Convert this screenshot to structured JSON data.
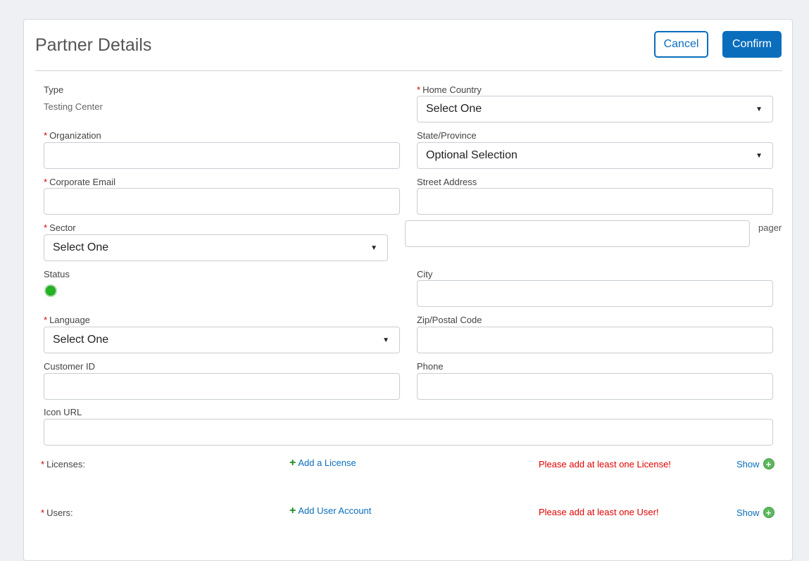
{
  "header": {
    "title": "Partner Details",
    "cancel_label": "Cancel",
    "confirm_label": "Confirm"
  },
  "fields": {
    "type": {
      "label": "Type",
      "value": "Testing Center"
    },
    "organization": {
      "label": "Organization",
      "value": ""
    },
    "corporate_email": {
      "label": "Corporate Email",
      "value": ""
    },
    "sector": {
      "label": "Sector",
      "value": "Select One"
    },
    "status": {
      "label": "Status",
      "color": "#22b522"
    },
    "language": {
      "label": "Language",
      "value": "Select One"
    },
    "customer_id": {
      "label": "Customer ID",
      "value": ""
    },
    "icon_url": {
      "label": "Icon URL",
      "value": ""
    },
    "home_country": {
      "label": "Home Country",
      "value": "Select One"
    },
    "state_province": {
      "label": "State/Province",
      "value": "Optional Selection"
    },
    "street_address": {
      "label": "Street Address",
      "value": ""
    },
    "street_address_2": {
      "value": "",
      "suffix": "pager"
    },
    "city": {
      "label": "City",
      "value": ""
    },
    "zip": {
      "label": "Zip/Postal Code",
      "value": ""
    },
    "phone": {
      "label": "Phone",
      "value": ""
    }
  },
  "licenses": {
    "label": "Licenses:",
    "add_label": "Add a License",
    "warning": "Please add at least one License!",
    "show_label": "Show"
  },
  "users": {
    "label": "Users:",
    "add_label": "Add User Account",
    "warning": "Please add at least one User!",
    "show_label": "Show"
  },
  "colors": {
    "accent": "#0a6ebd",
    "required": "#d40000",
    "warning": "#e00000",
    "success": "#22b522"
  },
  "required_marker": "*"
}
